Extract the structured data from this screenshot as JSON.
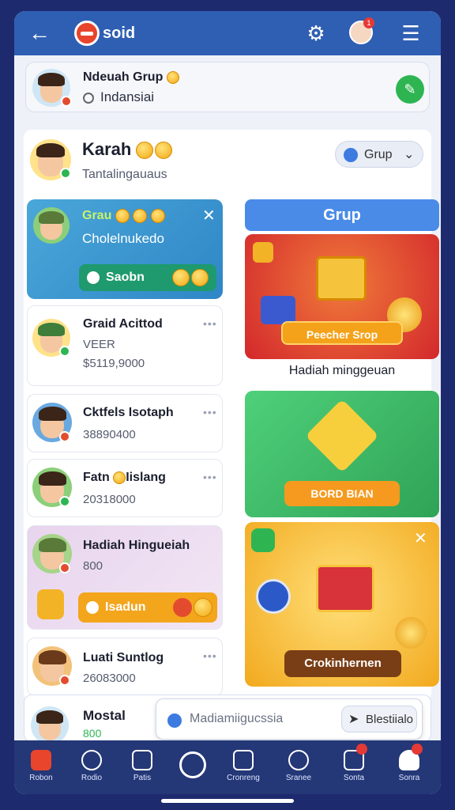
{
  "topbar": {
    "title": "soid",
    "back_icon": "arrow-left-icon",
    "settings_icon": "gear-icon",
    "menu_icon": "hamburger-icon",
    "notif_count": "1"
  },
  "group_banner": {
    "title": "Ndeuah Grup",
    "subtitle": "Indansiai"
  },
  "profile": {
    "name": "Karah",
    "subtitle": "Tantalingauaus",
    "group_select": "Grup"
  },
  "challenge": {
    "title": "Grau",
    "subtitle": "Cholelnukedo",
    "button": "Saobn"
  },
  "grup_header": "Grup",
  "list": [
    {
      "name": "Graid Acittod",
      "line2": "VEER",
      "line3": "$5119,9000"
    },
    {
      "name": "Cktfels Isotaph",
      "line2": "38890400",
      "line3": ""
    },
    {
      "name": "Fatn",
      "name2": "Iislang",
      "line2": "20318000",
      "line3": ""
    },
    {
      "name": "Hadiah Hingueiah",
      "line2": "800",
      "line3": "",
      "button": "Isadun"
    },
    {
      "name": "Luati Suntlog",
      "line2": "26083000",
      "line3": ""
    }
  ],
  "rewards": [
    {
      "button": "Peecher Srop",
      "caption": "Hadiah minggeuan",
      "color": "#e03a2c"
    },
    {
      "button": "BORD BIAN",
      "caption": "",
      "color": "#3dbd62"
    },
    {
      "button": "Crokinhernen",
      "caption": "",
      "color": "#f2b426"
    }
  ],
  "bottom_card": {
    "name": "Mostal",
    "value": "800",
    "search_placeholder": "Madiamiigucssia",
    "action": "Blestiialo"
  },
  "nav": [
    {
      "label": "Robon"
    },
    {
      "label": "Rodio"
    },
    {
      "label": "Patis"
    },
    {
      "label": ""
    },
    {
      "label": "Cronreng"
    },
    {
      "label": "Sranee"
    },
    {
      "label": "Sonta"
    },
    {
      "label": "Sonra"
    }
  ]
}
